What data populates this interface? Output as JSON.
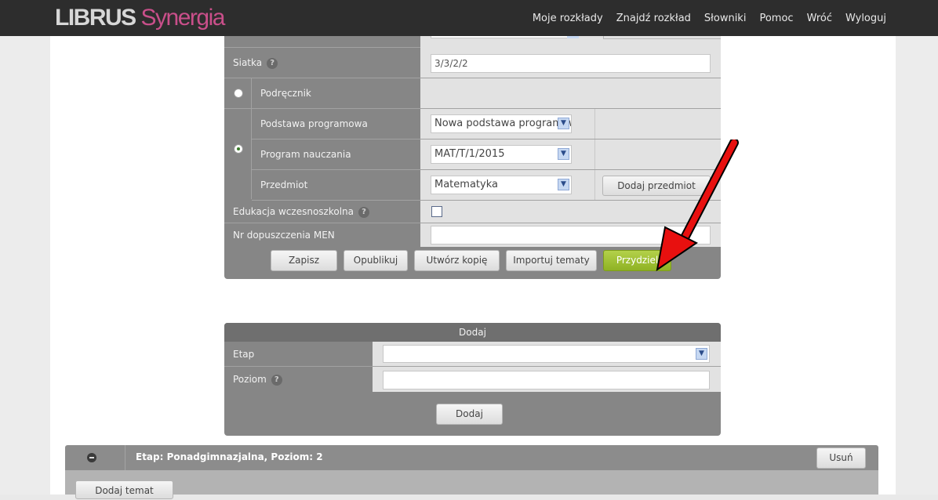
{
  "header": {
    "logo_librus": "LIBRUS",
    "logo_synergia": "Synergia",
    "nav": [
      "Moje rozkłady",
      "Znajdź rozkład",
      "Słowniki",
      "Pomoc",
      "Wróć",
      "Wyloguj"
    ]
  },
  "form": {
    "siatka_label": "Siatka",
    "siatka_value": "3/3/2/2",
    "podrecznik_label": "Podręcznik",
    "podstawa_label": "Podstawa programowa",
    "podstawa_value": "Nowa podstawa programowa",
    "program_label": "Program nauczania",
    "program_value": "MAT/T/1/2015",
    "przedmiot_label": "Przedmiot",
    "przedmiot_value": "Matematyka",
    "dodaj_przedmiot": "Dodaj przedmiot",
    "edukacja_label": "Edukacja wczesnoszkolna",
    "nr_label": "Nr dopuszczenia MEN",
    "nr_value": "",
    "buttons": {
      "zapisz": "Zapisz",
      "opublikuj": "Opublikuj",
      "kopia": "Utwórz kopię",
      "importuj": "Importuj tematy",
      "przydziel": "Przydziel"
    }
  },
  "dodaj_form": {
    "title": "Dodaj",
    "etap_label": "Etap",
    "etap_value": "",
    "poziom_label": "Poziom",
    "poziom_value": "",
    "submit": "Dodaj"
  },
  "etap_section": {
    "title": "Etap: Ponadgimnazjalna, Poziom: 2",
    "usun": "Usuń",
    "dodaj_temat": "Dodaj temat"
  },
  "colors": {
    "topbar": "#2d2d2d",
    "panel": "#868686",
    "accent_green": "#9dbf2e",
    "arrow": "#e8100f"
  }
}
